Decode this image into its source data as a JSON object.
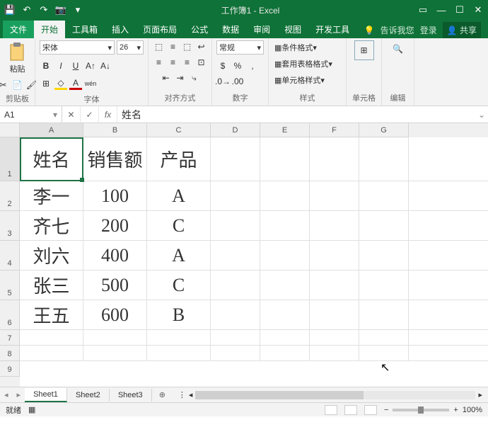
{
  "title_doc": "工作簿1 - Excel",
  "menu": {
    "file": "文件",
    "home": "开始",
    "toolbox": "工具箱",
    "insert": "插入",
    "layout": "页面布局",
    "formula": "公式",
    "data": "数据",
    "review": "审阅",
    "view": "视图",
    "dev": "开发工具",
    "tellme": "告诉我您",
    "login": "登录",
    "share": "共享"
  },
  "ribbon": {
    "clipboard": {
      "label": "剪贴板",
      "paste": "粘贴"
    },
    "font": {
      "label": "字体",
      "name": "宋体",
      "size": "26"
    },
    "align": {
      "label": "对齐方式"
    },
    "number": {
      "label": "数字",
      "format": "常规"
    },
    "styles": {
      "label": "样式",
      "cond": "条件格式",
      "tablefmt": "套用表格格式",
      "cellfmt": "单元格样式"
    },
    "cells": {
      "label": "单元格"
    },
    "edit": {
      "label": "编辑"
    }
  },
  "namebox": "A1",
  "formula": "姓名",
  "cols": [
    "A",
    "B",
    "C",
    "D",
    "E",
    "F",
    "G"
  ],
  "rows": [
    "1",
    "2",
    "3",
    "4",
    "5",
    "6",
    "7",
    "8",
    "9"
  ],
  "chart_data": {
    "type": "table",
    "headers": [
      "姓名",
      "销售额",
      "产品"
    ],
    "rows": [
      [
        "李一",
        "100",
        "A"
      ],
      [
        "齐七",
        "200",
        "C"
      ],
      [
        "刘六",
        "400",
        "A"
      ],
      [
        "张三",
        "500",
        "C"
      ],
      [
        "王五",
        "600",
        "B"
      ]
    ]
  },
  "sheets": [
    "Sheet1",
    "Sheet2",
    "Sheet3"
  ],
  "status": {
    "ready": "就绪",
    "zoom": "100%"
  }
}
